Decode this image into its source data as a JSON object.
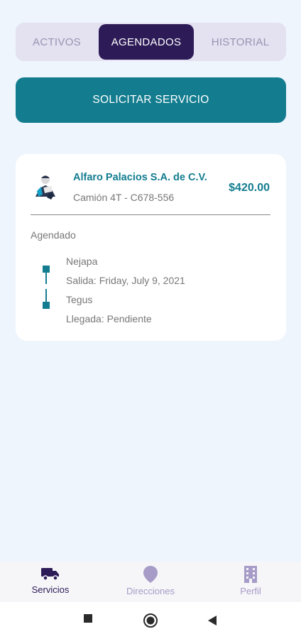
{
  "tabs": [
    {
      "label": "ACTIVOS",
      "active": false
    },
    {
      "label": "AGENDADOS",
      "active": true
    },
    {
      "label": "HISTORIAL",
      "active": false
    }
  ],
  "primary_button": {
    "label": "SOLICITAR SERVICIO"
  },
  "service_card": {
    "company": "Alfaro Palacios S.A. de C.V.",
    "vehicle": "Camión 4T - C678-556",
    "price": "$420.00",
    "status": "Agendado",
    "origin": "Nejapa",
    "departure": "Salida: Friday, July 9, 2021",
    "destination": "Tegus",
    "arrival": "Llegada: Pendiente",
    "avatar_icon": "driver-avatar-icon"
  },
  "bottom_nav": [
    {
      "label": "Servicios",
      "icon": "truck-icon",
      "active": true
    },
    {
      "label": "Direcciones",
      "icon": "location-pin-icon",
      "active": false
    },
    {
      "label": "Perfil",
      "icon": "building-icon",
      "active": false
    }
  ],
  "system_nav": {
    "buttons": [
      "recents-icon",
      "home-icon",
      "back-icon"
    ]
  },
  "colors": {
    "background": "#eef5fd",
    "primary_teal": "#137d8f",
    "dark_purple": "#2d1b57",
    "tabs_bg": "#e4e1f1",
    "inactive_purple": "#a69cc7"
  }
}
